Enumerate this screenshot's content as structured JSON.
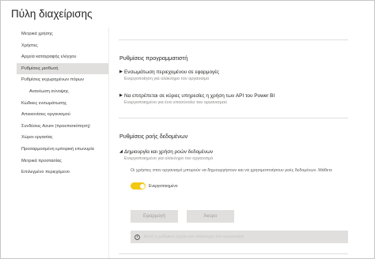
{
  "header": {
    "title": "Πύλη διαχείρισης"
  },
  "sidebar": {
    "items": [
      {
        "label": "Μετρικά χρήσης"
      },
      {
        "label": "Χρήστες"
      },
      {
        "label": "Αρχεία καταγραφής ελέγχου"
      },
      {
        "label": "Ρυθμίσεις μισθωτή"
      },
      {
        "label": "Ρυθμίσεις εκχωρημένων πόρων"
      },
      {
        "label": "Ανανέωση σύνοψης"
      },
      {
        "label": "Κώδικες ενσωμάτωσης"
      },
      {
        "label": "Απεικονίσεις οργανισμού"
      },
      {
        "label": "Συνδέσεις Azure (προεπισκόπηση)"
      },
      {
        "label": "Χώροι εργασίας"
      },
      {
        "label": "Προσαρμοσμένη εμπορική επωνυμία"
      },
      {
        "label": "Μετρικά προστασίας"
      },
      {
        "label": "Επιλεγμένο περιεχόμενο"
      }
    ]
  },
  "developer": {
    "title": "Ρυθμίσεις προγραμματιστή",
    "items": [
      {
        "title": "Ενσωμάτωση περιεχομένου σε εφαρμογές",
        "status": "Ενεργοποίηση για ολόκληρο τον οργανισμό"
      },
      {
        "title": "Να επιτρέπεται σε κύριες υπηρεσίες η χρήση των API του Power BI",
        "status": "Ενεργοποιημένο για ένα υποσύνολο του οργανισμού"
      }
    ]
  },
  "dataflow": {
    "title": "Ρυθμίσεις ροής δεδομένων",
    "item": {
      "title": "Δημιουργία και χρήση ροών δεδομένων",
      "status": "Ενεργοποιημένο για ολόκληρο τον οργανισμό"
    },
    "description": "Οι χρήστες στον οργανισμό μπορούν να δημιουργήσουν και να χρησιμοποιήσουν ροές δεδομένων. Μάθετε",
    "toggle": {
      "on": true,
      "label": "Ενεργοποιημένο"
    },
    "apply_label": "Εφαρμογή",
    "cancel_label": "Άκυρο",
    "info_text": "Αυτή η ρύθμιση ισχύει για ολόκληρο τον οργανισμό"
  },
  "colors": {
    "toggle_on": "#f2c811",
    "active_item": "#e1dfdd",
    "button_disabled": "#e1dfdd"
  },
  "icons": {
    "expanded": "caret-down-icon",
    "collapsed": "caret-right-icon",
    "info": "info-icon"
  }
}
